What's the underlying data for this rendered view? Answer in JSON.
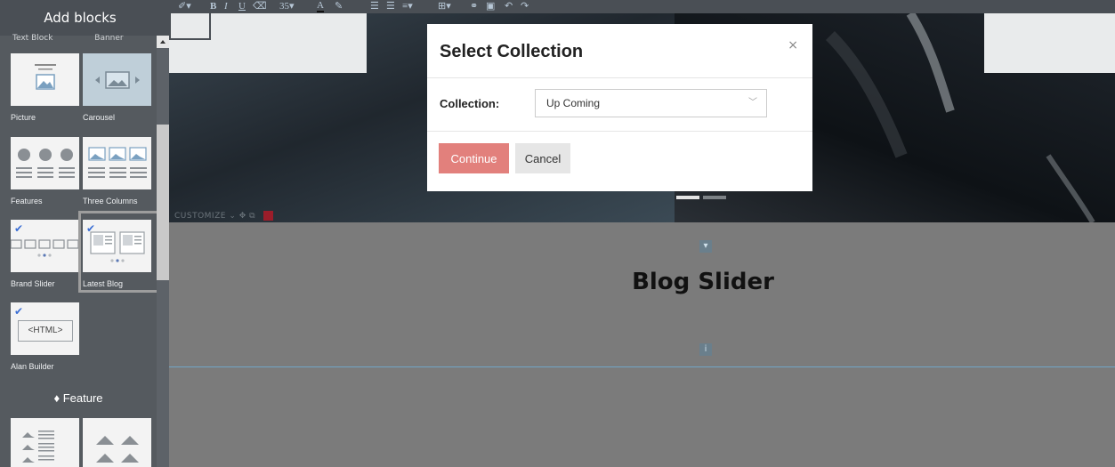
{
  "sidebar": {
    "title": "Add blocks",
    "cutoff_labels": [
      "Text Block",
      "Banner"
    ],
    "blocks": [
      {
        "label": "Picture"
      },
      {
        "label": "Carousel"
      },
      {
        "label": "Features"
      },
      {
        "label": "Three Columns"
      },
      {
        "label": "Brand Slider"
      },
      {
        "label": "Latest Blog"
      },
      {
        "label": "Alan Builder",
        "thumb_text": "<HTML>"
      }
    ],
    "feature_section": "Feature"
  },
  "toolbar": {
    "font_size": "35",
    "icons": [
      "brush-icon",
      "bold-icon",
      "italic-icon",
      "underline-icon",
      "eraser-icon",
      "font-size-select",
      "text-color-icon",
      "highlight-icon",
      "unordered-list-icon",
      "ordered-list-icon",
      "align-icon",
      "table-icon",
      "link-icon",
      "image-icon",
      "undo-icon",
      "redo-icon"
    ]
  },
  "canvas": {
    "customize_label": "CUSTOMIZE",
    "blog_title": "Blog Slider"
  },
  "modal": {
    "title": "Select Collection",
    "close": "×",
    "field_label": "Collection:",
    "selected_value": "Up Coming",
    "continue_label": "Continue",
    "cancel_label": "Cancel"
  },
  "colors": {
    "accent": "#e2807c",
    "sidebar_bg": "#555a5f",
    "pro_badge": "#3b6ed4"
  }
}
